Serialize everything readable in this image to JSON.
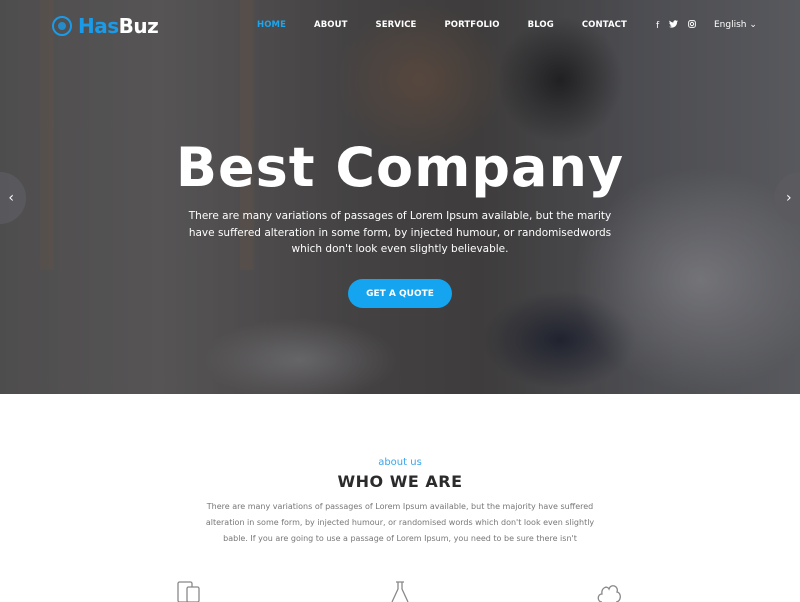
{
  "brand": {
    "name_part1": "Has",
    "name_part2": "Buz",
    "accent_color": "#1a9bea"
  },
  "nav": {
    "items": [
      {
        "label": "HOME",
        "active": true
      },
      {
        "label": "ABOUT",
        "active": false
      },
      {
        "label": "SERVICE",
        "active": false
      },
      {
        "label": "PORTFOLIO",
        "active": false
      },
      {
        "label": "BLOG",
        "active": false
      },
      {
        "label": "CONTACT",
        "active": false
      }
    ]
  },
  "social": {
    "facebook": "f",
    "twitter": "🐦︎",
    "instagram": "◎"
  },
  "language": {
    "selected": "English ⌄"
  },
  "hero": {
    "title": "Best Company",
    "subtitle": "There are many variations of passages of Lorem Ipsum available, but the marity have suffered alteration in some form, by injected humour, or randomisedwords which don't look even slightly believable.",
    "cta_label": "GET A QUOTE",
    "prev_icon": "‹",
    "next_icon": "›"
  },
  "about": {
    "kicker": "about us",
    "title": "WHO WE ARE",
    "text": "There are many variations of passages of Lorem Ipsum available, but the majority have suffered alteration in some form, by injected humour, or randomised words which don't look even slightly bable. If you are going to use a passage of Lorem Ipsum, you need to be sure there isn't",
    "feature_icons": [
      "devices-icon",
      "flask-icon",
      "cloud-icon"
    ]
  }
}
